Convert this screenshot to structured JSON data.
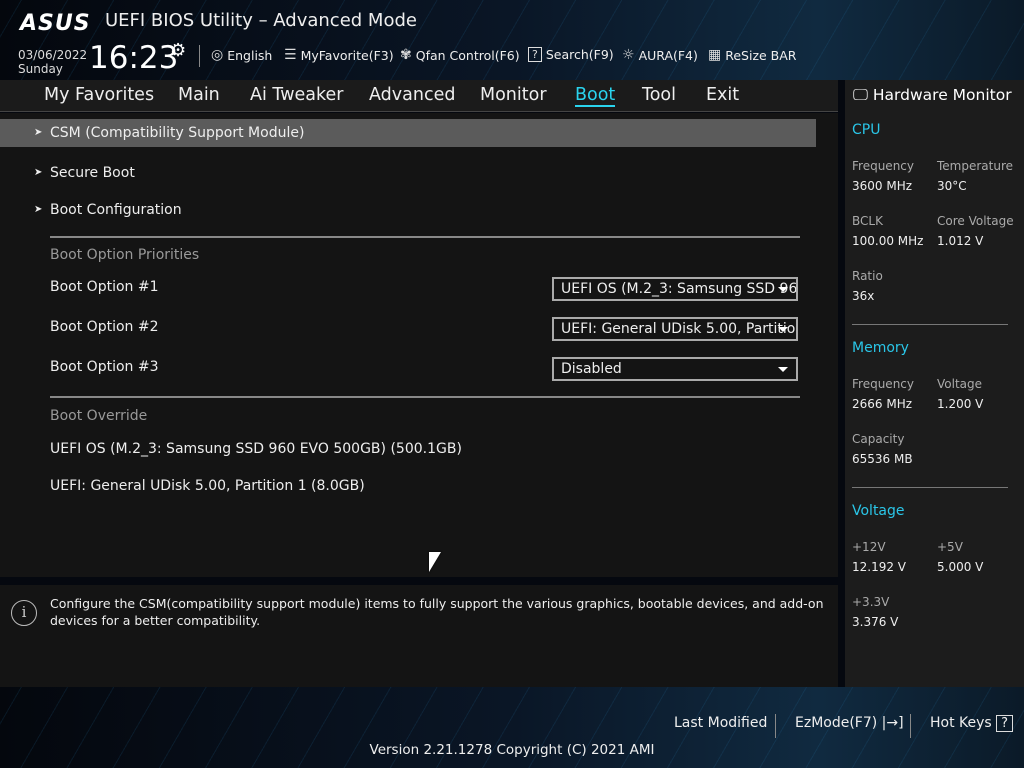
{
  "header": {
    "logo": "ASUS",
    "title": "UEFI BIOS Utility – Advanced Mode",
    "date": "03/06/2022",
    "day": "Sunday",
    "time": "16:23",
    "tools": [
      {
        "icon": "globe-icon",
        "glyph": "🌐",
        "label": "English"
      },
      {
        "icon": "favorite-list-icon",
        "glyph": "☰",
        "label": "MyFavorite(F3)"
      },
      {
        "icon": "fan-icon",
        "glyph": "✾",
        "label": "Qfan Control(F6)"
      },
      {
        "icon": "search-help-icon",
        "glyph": "?",
        "label": "Search(F9)"
      },
      {
        "icon": "aura-light-icon",
        "glyph": "☼",
        "label": "AURA(F4)"
      },
      {
        "icon": "resize-bar-icon",
        "glyph": "▦",
        "label": "ReSize BAR"
      }
    ]
  },
  "nav": {
    "tabs": [
      "My Favorites",
      "Main",
      "Ai Tweaker",
      "Advanced",
      "Monitor",
      "Boot",
      "Tool",
      "Exit"
    ],
    "active": "Boot"
  },
  "main": {
    "menus": [
      "CSM (Compatibility Support Module)",
      "Secure Boot",
      "Boot Configuration"
    ],
    "priorities_header": "Boot Option Priorities",
    "options": [
      {
        "label": "Boot Option #1",
        "value": "UEFI OS (M.2_3: Samsung SSD 960 EVO 500GB) (500.1GB)"
      },
      {
        "label": "Boot Option #2",
        "value": "UEFI: General UDisk 5.00, Partition 1 (8.0GB)"
      },
      {
        "label": "Boot Option #3",
        "value": "Disabled"
      }
    ],
    "override_header": "Boot Override",
    "overrides": [
      "UEFI OS (M.2_3: Samsung SSD 960 EVO 500GB) (500.1GB)",
      "UEFI: General UDisk 5.00, Partition 1 (8.0GB)"
    ]
  },
  "help": {
    "text": "Configure the CSM(compatibility support module) items to fully support the various graphics, bootable devices, and add-on devices for a better compatibility."
  },
  "hw": {
    "title": "Hardware Monitor",
    "cpu": {
      "title": "CPU",
      "freq_l": "Frequency",
      "freq": "3600 MHz",
      "temp_l": "Temperature",
      "temp": "30°C",
      "bclk_l": "BCLK",
      "bclk": "100.00 MHz",
      "cv_l": "Core Voltage",
      "cv": "1.012 V",
      "ratio_l": "Ratio",
      "ratio": "36x"
    },
    "mem": {
      "title": "Memory",
      "freq_l": "Frequency",
      "freq": "2666 MHz",
      "volt_l": "Voltage",
      "volt": "1.200 V",
      "cap_l": "Capacity",
      "cap": "65536 MB"
    },
    "volt": {
      "title": "Voltage",
      "v12_l": "+12V",
      "v12": "12.192 V",
      "v5_l": "+5V",
      "v5": "5.000 V",
      "v33_l": "+3.3V",
      "v33": "3.376 V"
    }
  },
  "footer": {
    "last_modified": "Last Modified",
    "ezmode": "EzMode(F7)",
    "hotkeys": "Hot Keys",
    "version": "Version 2.21.1278 Copyright (C) 2021 AMI"
  }
}
